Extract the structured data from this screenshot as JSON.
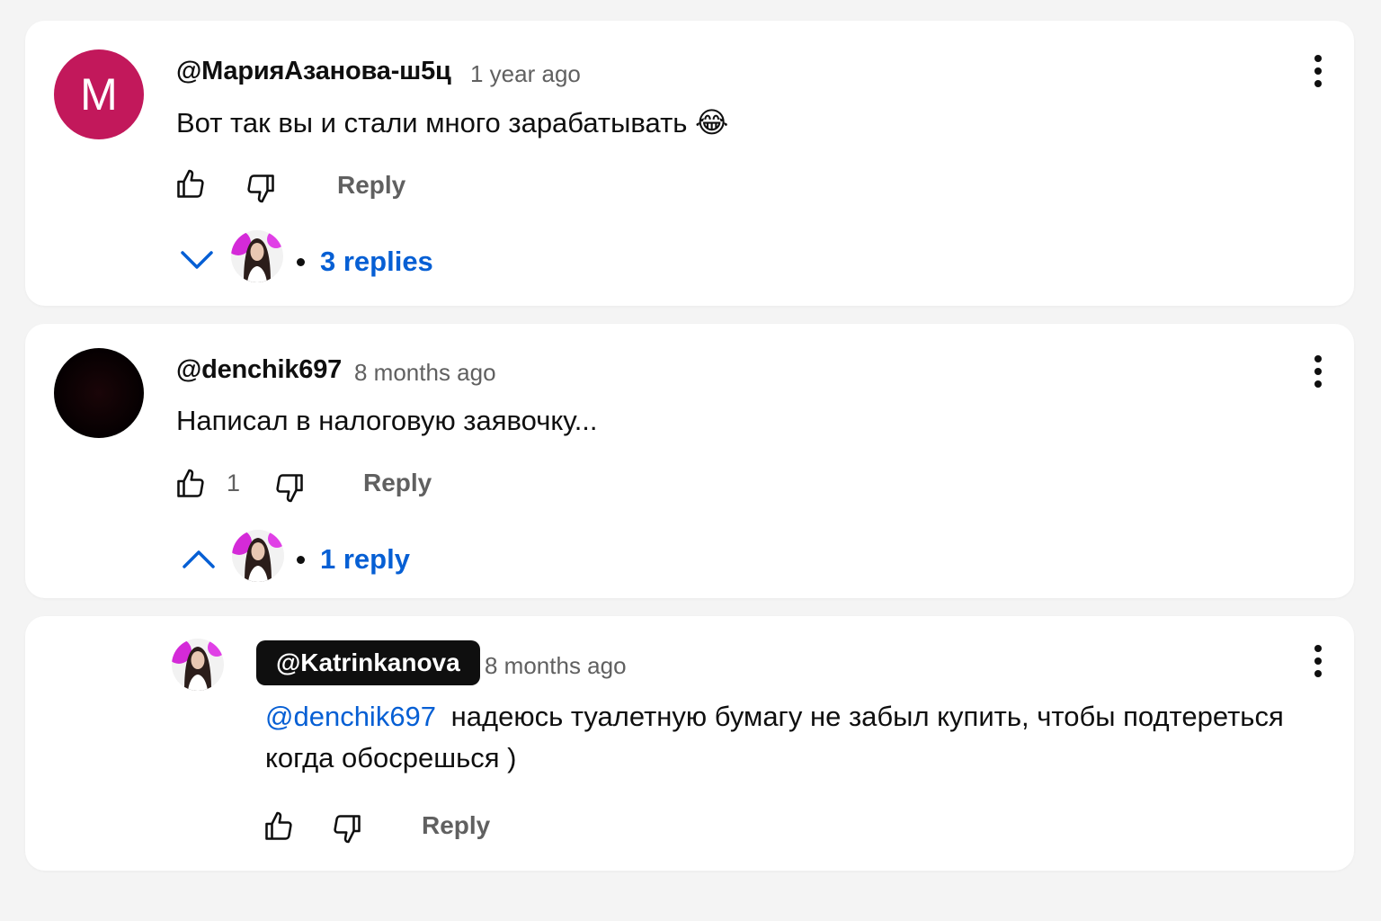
{
  "comments": [
    {
      "author": "@МарияАзанова-ш5ц",
      "avatar_letter": "M",
      "avatar_color": "#c2185b",
      "time": "1 year ago",
      "text": "Вот так вы и стали много зарабатывать",
      "emoji": "😂",
      "like_count": "",
      "reply_label": "Reply",
      "replies_label": "3 replies",
      "replies_toggle_icon": "chevron-down-icon"
    },
    {
      "author": "@denchik697",
      "time": "8 months ago",
      "text": "Написал в налоговую заявочку...",
      "like_count": "1",
      "reply_label": "Reply",
      "replies_label": "1 reply",
      "replies_toggle_icon": "chevron-up-icon"
    }
  ],
  "reply": {
    "author": "@Katrinkanova",
    "time": "8 months ago",
    "mention": "@denchik697",
    "text_line1": " надеюсь туалетную бумагу не забыл купить, чтобы подтереться",
    "text_line2": "когда обосрешься )",
    "reply_label": "Reply"
  },
  "colors": {
    "link": "#065fd4",
    "secondary_text": "#606060",
    "card_bg": "#ffffff",
    "page_bg": "#f4f4f4"
  }
}
